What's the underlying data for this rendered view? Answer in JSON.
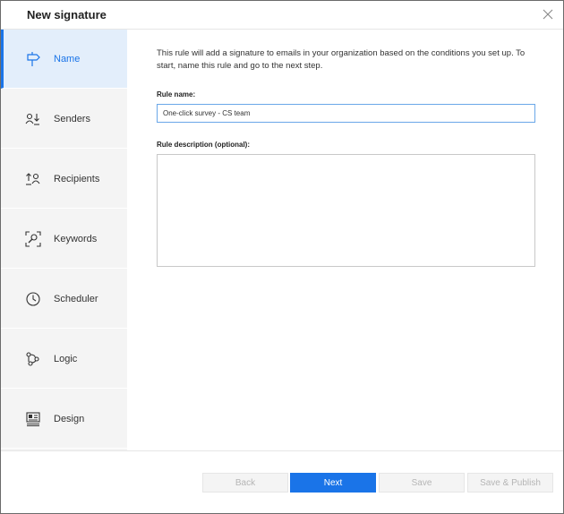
{
  "dialog": {
    "title": "New signature",
    "close_icon": "close-icon"
  },
  "sidebar": {
    "items": [
      {
        "label": "Name",
        "icon": "signpost-icon",
        "active": true
      },
      {
        "label": "Senders",
        "icon": "senders-icon",
        "active": false
      },
      {
        "label": "Recipients",
        "icon": "recipients-icon",
        "active": false
      },
      {
        "label": "Keywords",
        "icon": "keywords-icon",
        "active": false
      },
      {
        "label": "Scheduler",
        "icon": "clock-icon",
        "active": false
      },
      {
        "label": "Logic",
        "icon": "logic-icon",
        "active": false
      },
      {
        "label": "Design",
        "icon": "design-icon",
        "active": false
      }
    ]
  },
  "main": {
    "intro": "This rule will add a signature to emails in your organization based on the conditions you set up. To start, name this rule and go to the next step.",
    "rule_name_label": "Rule name:",
    "rule_name_value": "One-click survey - CS team",
    "rule_description_label": "Rule description (optional):",
    "rule_description_value": ""
  },
  "footer": {
    "back_label": "Back",
    "next_label": "Next",
    "save_label": "Save",
    "save_publish_label": "Save & Publish"
  },
  "colors": {
    "accent": "#1a74e8",
    "active_bg": "#e3eefb",
    "sidebar_bg": "#f4f4f4"
  }
}
